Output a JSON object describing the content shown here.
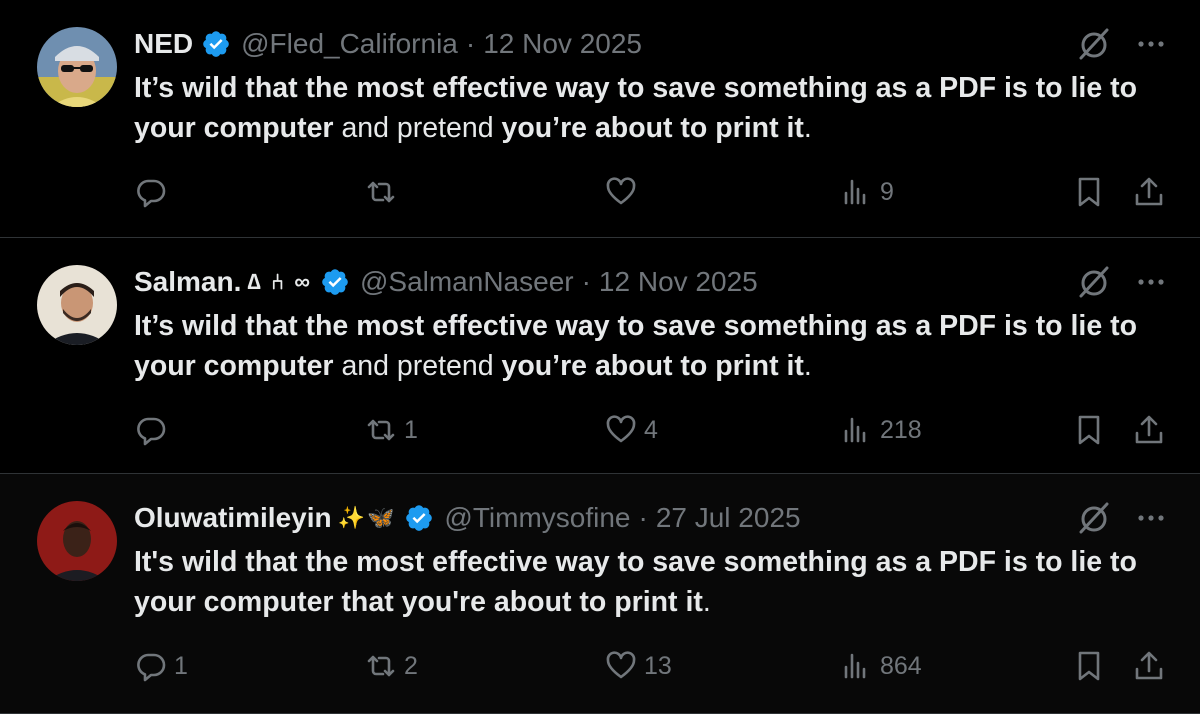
{
  "colors": {
    "background": "#000000",
    "text_primary": "#e7e9ea",
    "text_secondary": "#71767b",
    "verified_blue": "#1d9bf0",
    "divider": "#2f3336"
  },
  "tweets": [
    {
      "display_name": "NED",
      "name_decor": "",
      "handle": "@Fled_California",
      "separator": "·",
      "date": "12 Nov 2025",
      "avatar_icon": "avatar-man-sunglasses",
      "text_parts": [
        {
          "text": "It’s wild that the most effective way to save something as a PDF is to lie to your computer",
          "bold": true
        },
        {
          "text": " and pretend ",
          "bold": false
        },
        {
          "text": "you’re about to print it",
          "bold": true
        },
        {
          "text": ".",
          "bold": false
        }
      ],
      "stats": {
        "replies": "",
        "reposts": "",
        "likes": "",
        "views": "9"
      }
    },
    {
      "display_name": "Salman.",
      "name_decor": "∆ ⑃ ∞",
      "handle": "@SalmanNaseer",
      "separator": "·",
      "date": "12 Nov 2025",
      "avatar_icon": "avatar-man-beard",
      "text_parts": [
        {
          "text": "It’s wild that the most effective way to save something as a PDF is to lie to your computer",
          "bold": true
        },
        {
          "text": " and pretend ",
          "bold": false
        },
        {
          "text": "you’re about to print it",
          "bold": true
        },
        {
          "text": ".",
          "bold": false
        }
      ],
      "stats": {
        "replies": "",
        "reposts": "1",
        "likes": "4",
        "views": "218"
      }
    },
    {
      "display_name": "Oluwatimileyin",
      "name_decor": "✨🦋",
      "handle": "@Timmysofine",
      "separator": "·",
      "date": "27 Jul 2025",
      "avatar_icon": "avatar-woman-red-background",
      "text_parts": [
        {
          "text": "It's wild that the most effective way to save something as a PDF is to lie to your computer that you're about to print it",
          "bold": true
        },
        {
          "text": ".",
          "bold": false
        }
      ],
      "stats": {
        "replies": "1",
        "reposts": "2",
        "likes": "13",
        "views": "864"
      }
    }
  ]
}
